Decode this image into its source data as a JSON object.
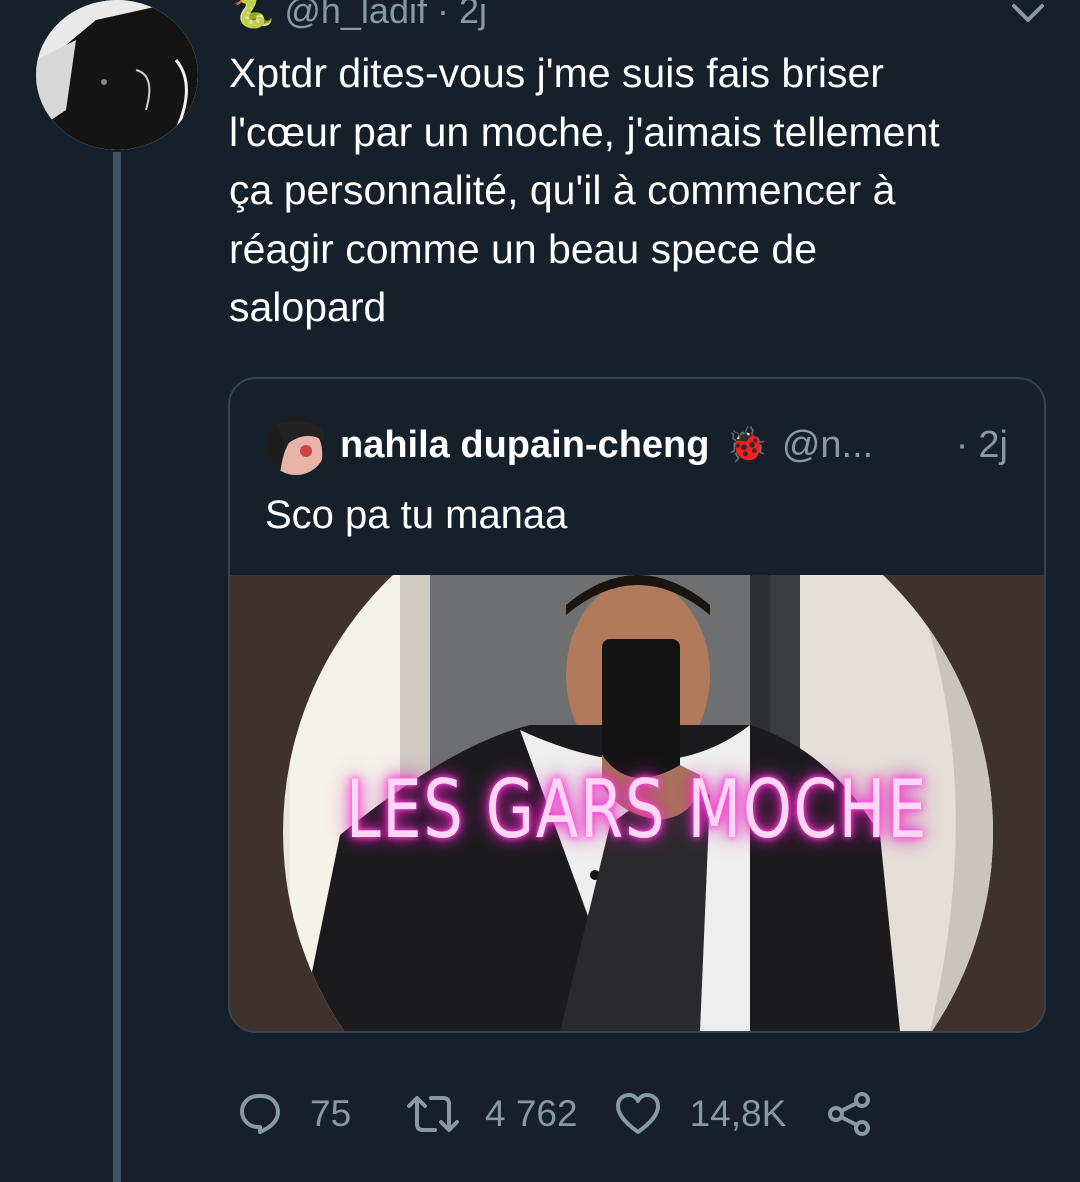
{
  "tweet": {
    "handle": "@h_ladif",
    "separator": "·",
    "time": "2j",
    "text_lines": [
      "Xptdr dites-vous j'me suis fais briser",
      "l'cœur par un moche, j'aimais tellement",
      "ça personnalité, qu'il à commencer à",
      "réagir comme un beau spece de",
      "salopard"
    ],
    "emoji": "🐍"
  },
  "quote": {
    "name": "nahila dupain-cheng",
    "emoji": "🐞",
    "handle": "@n...",
    "separator": "·",
    "time": "2j",
    "text": "Sco pa tu manaa",
    "image_caption": "LES GARS MOCHE"
  },
  "actions": {
    "replies": "75",
    "retweets": "4 762",
    "likes": "14,8K"
  },
  "colors": {
    "background": "#15202b",
    "secondary_text": "#8899a6",
    "border": "#38444d",
    "thread_line": "#3d5466",
    "neon_text": "#ffd6f6"
  },
  "icons": [
    "chevron-down-icon",
    "reply-icon",
    "retweet-icon",
    "like-icon",
    "share-icon"
  ]
}
